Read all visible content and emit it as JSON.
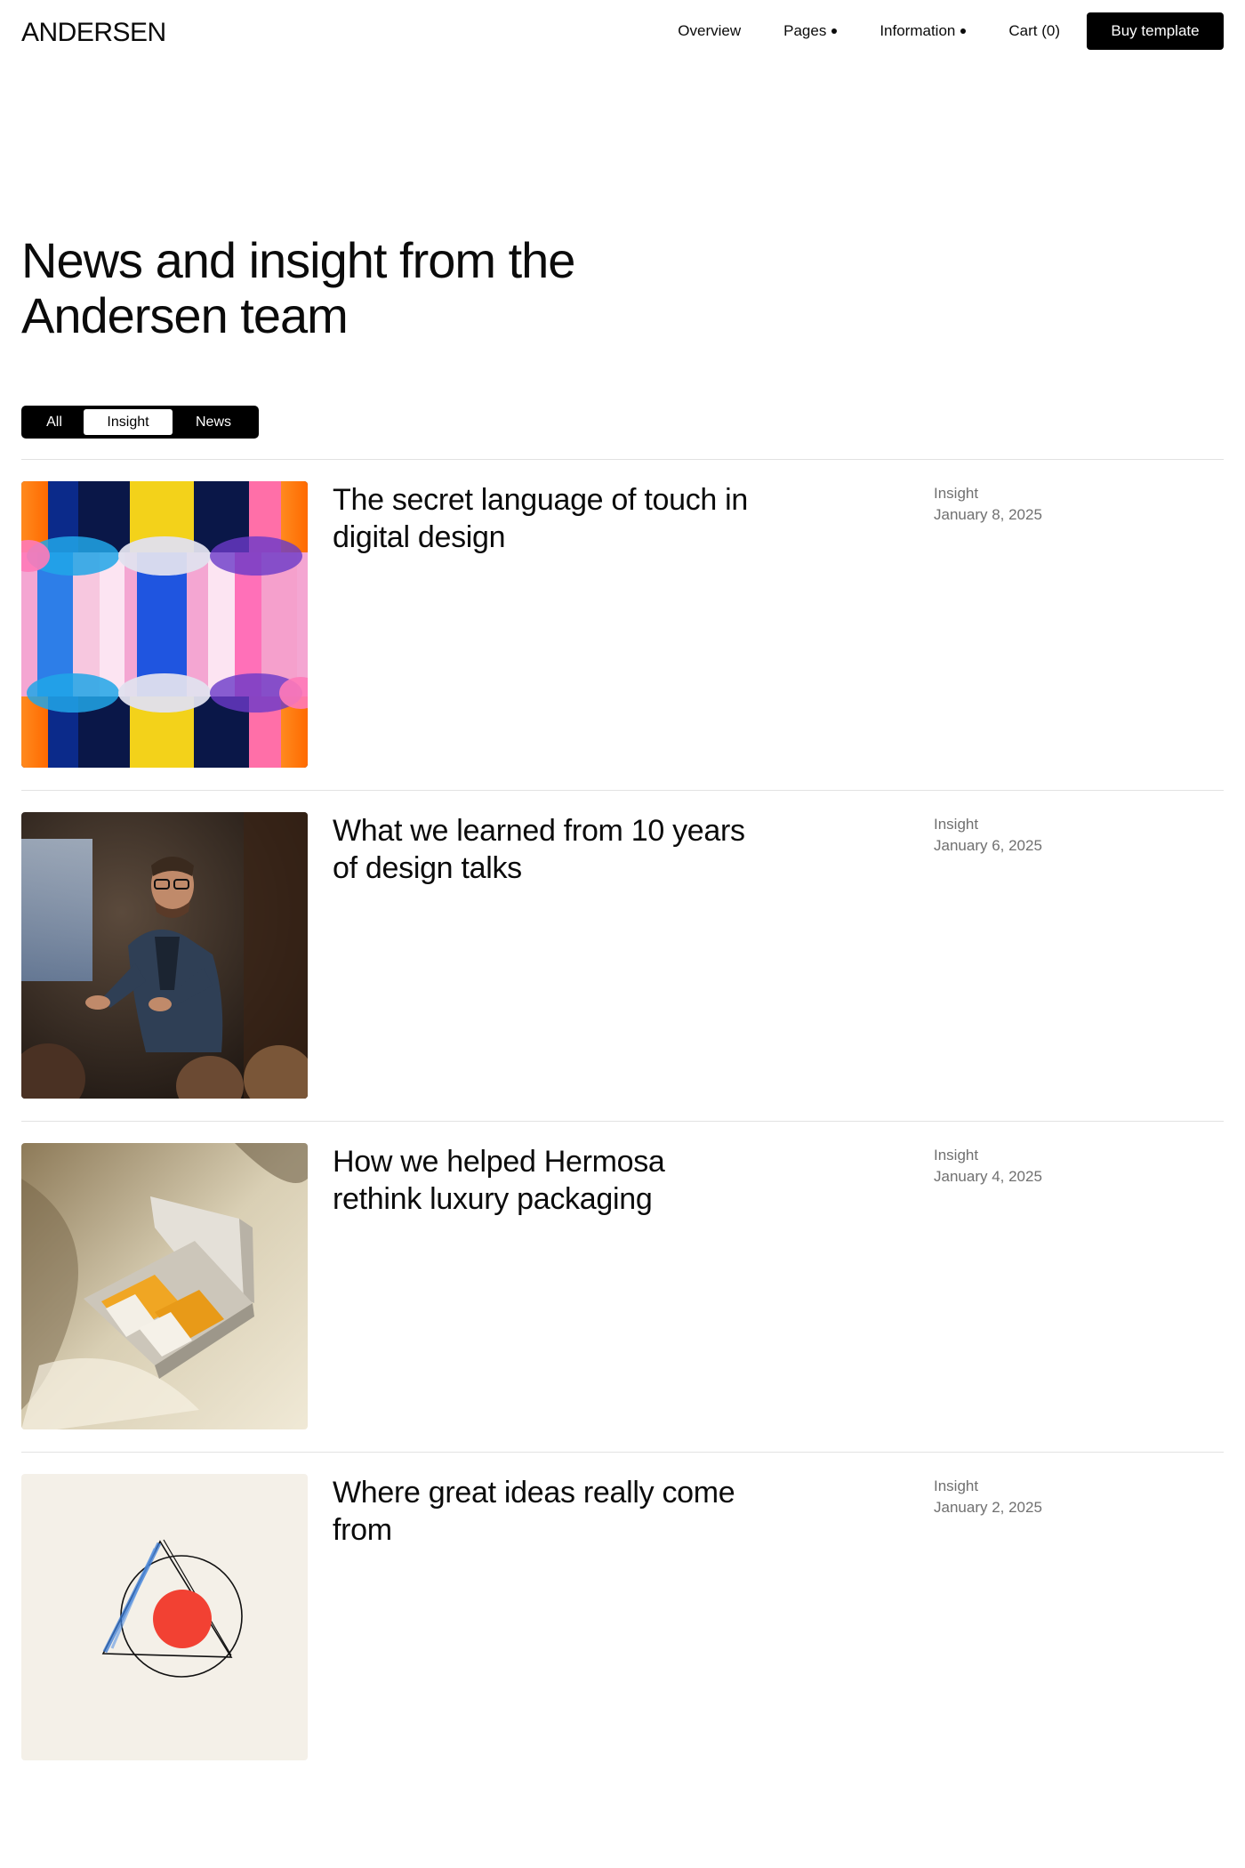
{
  "header": {
    "logo": "ANDERSEN",
    "nav": {
      "overview": "Overview",
      "pages": "Pages",
      "information": "Information",
      "cart": "Cart (0)"
    },
    "buy_label": "Buy template"
  },
  "hero": {
    "title_line1": "News and insight from the",
    "title_line2": "Andersen team"
  },
  "filters": {
    "all": "All",
    "insight": "Insight",
    "news": "News",
    "selected": "Insight"
  },
  "posts": [
    {
      "title": "The secret language of touch in digital design",
      "category": "Insight",
      "date": "January 8, 2025",
      "image_icon": "abstract-pattern-image"
    },
    {
      "title": "What we learned from 10 years of design talks",
      "category": "Insight",
      "date": "January 6, 2025",
      "image_icon": "speaker-photo"
    },
    {
      "title": "How we helped Hermosa rethink luxury packaging",
      "category": "Insight",
      "date": "January 4, 2025",
      "image_icon": "packaging-photo"
    },
    {
      "title": "Where great ideas really come from",
      "category": "Insight",
      "date": "January 2, 2025",
      "image_icon": "sketch-illustration"
    }
  ],
  "colors": {
    "accent": "#000000",
    "text": "#0b0b0b",
    "muted": "#707070",
    "divider": "#e2e2e2"
  }
}
